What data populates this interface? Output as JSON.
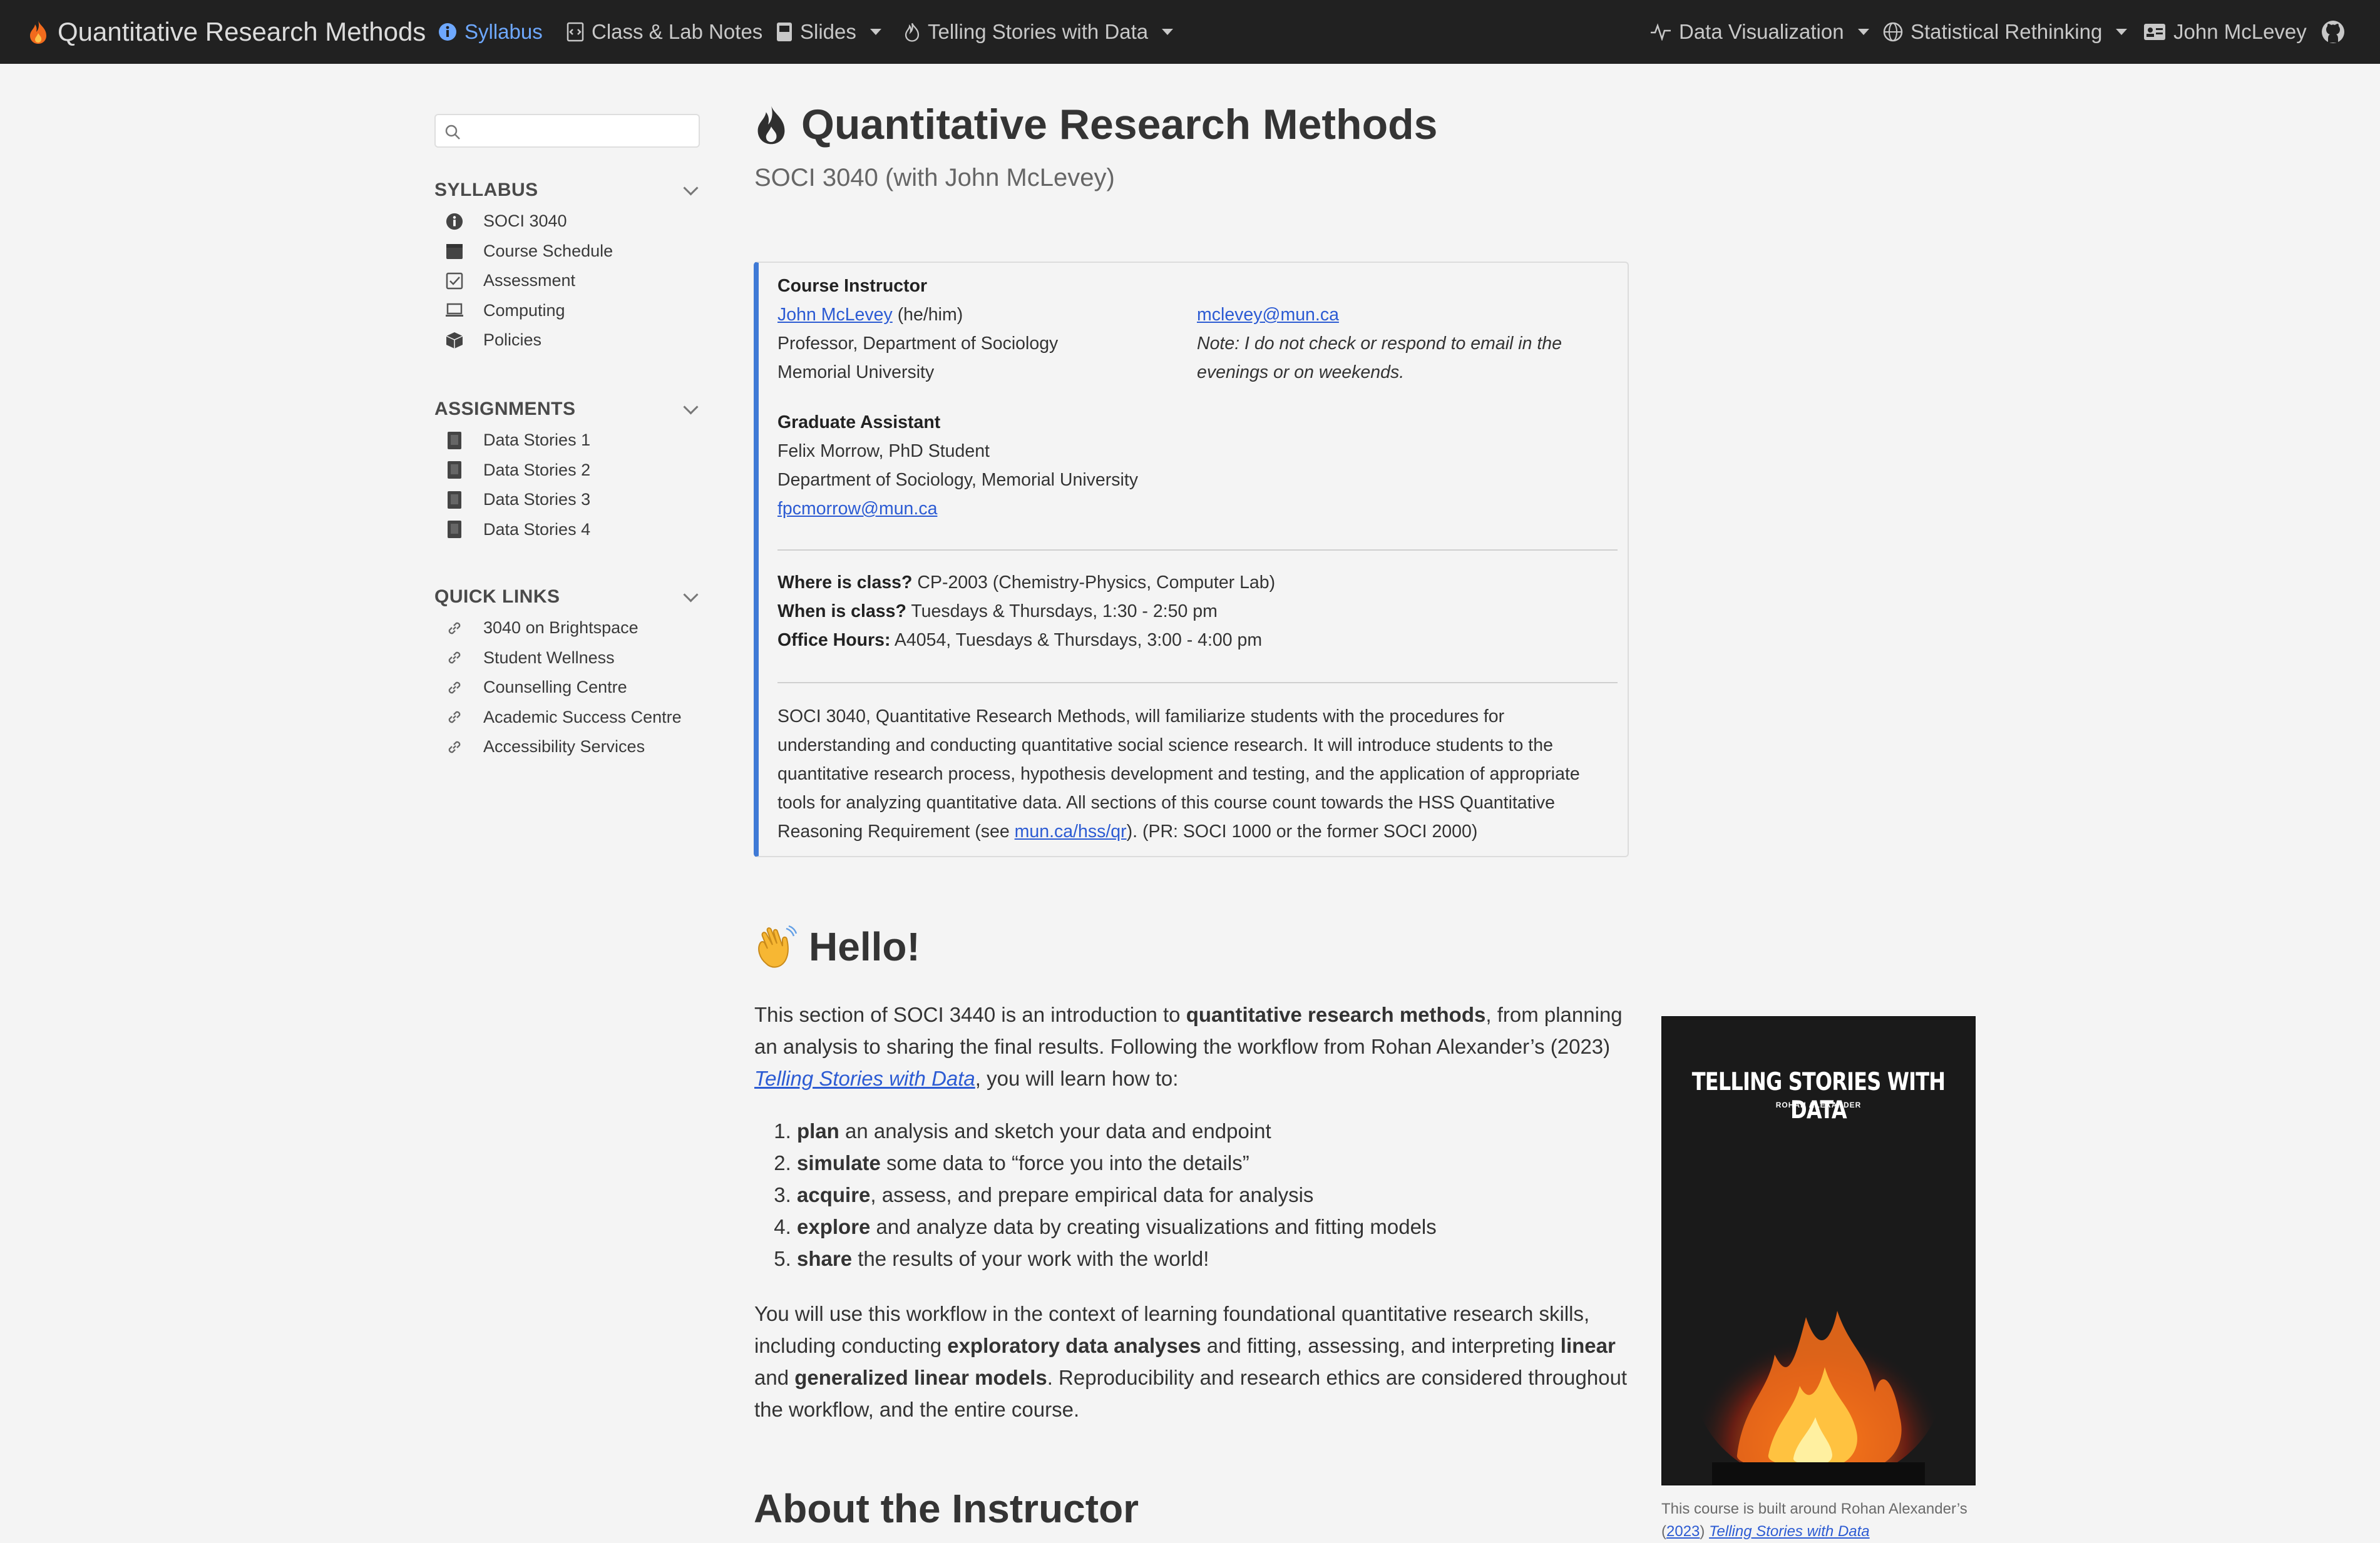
{
  "navbar": {
    "brand": "Quantitative Research Methods",
    "items": {
      "syllabus": "Syllabus",
      "notes": "Class & Lab Notes",
      "slides": "Slides",
      "telling": "Telling Stories with Data",
      "dataviz": "Data Visualization",
      "stats": "Statistical Rethinking",
      "profile": "John McLevey"
    },
    "accent_color": "#6ea8fe"
  },
  "sidebar": {
    "search_placeholder": "",
    "syllabus": {
      "heading": "SYLLABUS",
      "items": [
        "SOCI 3040",
        "Course Schedule",
        "Assessment",
        "Computing",
        "Policies"
      ]
    },
    "assignments": {
      "heading": "ASSIGNMENTS",
      "items": [
        "Data Stories 1",
        "Data Stories 2",
        "Data Stories 3",
        "Data Stories 4"
      ]
    },
    "quick_links": {
      "heading": "QUICK LINKS",
      "items": [
        "3040 on Brightspace",
        "Student Wellness",
        "Counselling Centre",
        "Academic Success Centre",
        "Accessibility Services"
      ]
    }
  },
  "main": {
    "title": "Quantitative Research Methods",
    "subtitle": "SOCI 3040 (with John McLevey)",
    "callout": {
      "instructor_heading": "Course Instructor",
      "instructor_name": "John McLevey",
      "instructor_pronouns": "(he/him)",
      "instructor_role": "Professor, Department of Sociology",
      "instructor_uni": "Memorial University",
      "instructor_email": "mclevey@mun.ca",
      "email_note_1": "Note: I do not check or respond to email in the",
      "email_note_2": "evenings or on weekends.",
      "ga_heading": "Graduate Assistant",
      "ga_name": "Felix Morrow, PhD Student",
      "ga_dept": "Department of Sociology, Memorial University",
      "ga_email": "fpcmorrow@mun.ca",
      "where_label": "Where is class?",
      "where_value": "CP-2003 (Chemistry-Physics, Computer Lab)",
      "when_label": "When is class?",
      "when_value": "Tuesdays & Thursdays, 1:30 - 2:50 pm",
      "office_label": "Office Hours:",
      "office_value": "A4054, Tuesdays & Thursdays, 3:00 - 4:00 pm",
      "desc_1": "SOCI 3040, Quantitative Research Methods, will familiarize students with the procedures for",
      "desc_2": "understanding and conducting quantitative social science research. It will introduce students to the",
      "desc_3": "quantitative research process, hypothesis development and testing, and the application of appropriate",
      "desc_4": "tools for analyzing quantitative data. All sections of this course count towards the HSS Quantitative",
      "desc_5a": "Reasoning Requirement (see ",
      "desc_link": "mun.ca/hss/qr",
      "desc_5b": "). (PR: SOCI 1000 or the former SOCI 2000)"
    },
    "hello": {
      "heading": "Hello!",
      "p1_a": "This section of SOCI 3440 is an introduction to ",
      "p1_b": "quantitative research methods",
      "p1_c": ", from planning an analysis to sharing the final results. Following the workflow from Rohan Alexander’s (2023) ",
      "p1_link": "Telling Stories with Data",
      "p1_d": ", you will learn how to:",
      "steps": [
        {
          "bold": "plan",
          "rest": " an analysis and sketch your data and endpoint"
        },
        {
          "bold": "simulate",
          "rest": " some data to “force you into the details”"
        },
        {
          "bold": "acquire",
          "rest": ", assess, and prepare empirical data for analysis"
        },
        {
          "bold": "explore",
          "rest": " and analyze data by creating visualizations and fitting models"
        },
        {
          "bold": "share",
          "rest": " the results of your work with the world!"
        }
      ],
      "p2_a": "You will use this workflow in the context of learning foundational quantitative research skills, including conducting ",
      "p2_b": "exploratory data analyses",
      "p2_c": " and fitting, assessing, and interpreting ",
      "p2_d": "linear",
      "p2_e": " and ",
      "p2_f": "generalized linear models",
      "p2_g": ". Reproducibility and research ethics are considered throughout the workflow, and the entire course."
    },
    "about_heading": "About the Instructor",
    "book": {
      "title": "TELLING STORIES WITH DATA",
      "author": "ROHAN ALEXANDER",
      "caption_a": "This course is built around Rohan Alexander’s (",
      "caption_year": "2023",
      "caption_b": ") ",
      "caption_link": "Telling Stories with Data"
    }
  }
}
